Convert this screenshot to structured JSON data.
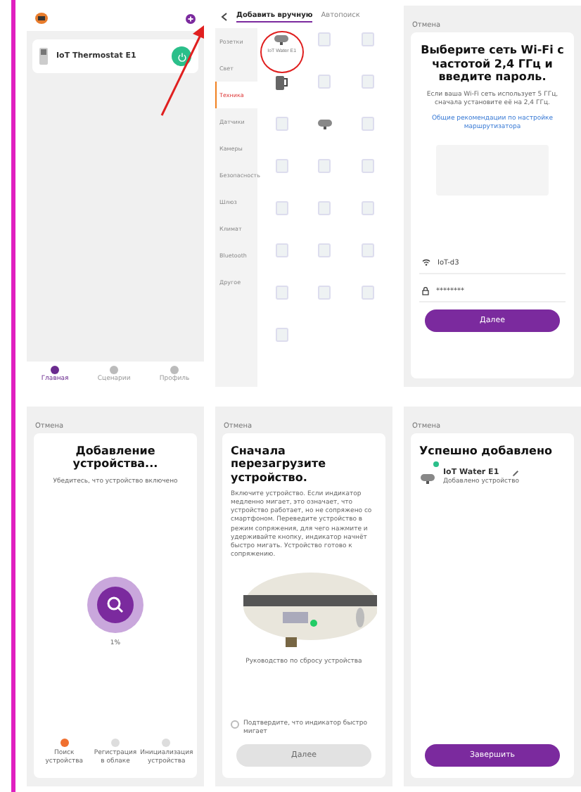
{
  "home": {
    "device": "IoT Thermostat E1",
    "arrow": true,
    "nav": [
      {
        "label": "Главная",
        "selected": true
      },
      {
        "label": "Сценарии",
        "selected": false
      },
      {
        "label": "Профиль",
        "selected": false
      }
    ]
  },
  "add_device": {
    "tabs": [
      {
        "label": "Добавить вручную",
        "selected": true
      },
      {
        "label": "Автопоиск",
        "selected": false
      }
    ],
    "categories": [
      {
        "label": "Розетки",
        "selected": false
      },
      {
        "label": "Свет",
        "selected": false
      },
      {
        "label": "Техника",
        "selected": true
      },
      {
        "label": "Датчики",
        "selected": false
      },
      {
        "label": "Камеры",
        "selected": false
      },
      {
        "label": "Безопасность",
        "selected": false
      },
      {
        "label": "Шлюз",
        "selected": false
      },
      {
        "label": "Климат",
        "selected": false
      },
      {
        "label": "Bluetooth",
        "selected": false
      },
      {
        "label": "Другое",
        "selected": false
      }
    ],
    "devices": [
      {
        "kind": "heater",
        "label": "IoT Water E1",
        "highlighted": true
      },
      {
        "kind": "generic",
        "highlighted": false
      },
      {
        "kind": "generic",
        "highlighted": false
      },
      {
        "kind": "kettle",
        "highlighted": false
      },
      {
        "kind": "generic",
        "highlighted": false
      },
      {
        "kind": "generic",
        "highlighted": false
      },
      {
        "kind": "generic",
        "highlighted": false
      },
      {
        "kind": "heater",
        "highlighted": false
      },
      {
        "kind": "generic",
        "highlighted": false
      },
      {
        "kind": "generic",
        "highlighted": false
      },
      {
        "kind": "generic",
        "highlighted": false
      },
      {
        "kind": "generic",
        "highlighted": false
      },
      {
        "kind": "generic",
        "highlighted": false
      },
      {
        "kind": "generic",
        "highlighted": false
      },
      {
        "kind": "generic",
        "highlighted": false
      },
      {
        "kind": "generic",
        "highlighted": false
      },
      {
        "kind": "generic",
        "highlighted": false
      },
      {
        "kind": "generic",
        "highlighted": false
      },
      {
        "kind": "generic",
        "highlighted": false
      },
      {
        "kind": "generic",
        "highlighted": false
      },
      {
        "kind": "generic",
        "highlighted": false
      },
      {
        "kind": "generic",
        "highlighted": false
      }
    ]
  },
  "wifi": {
    "cancel": "Отмена",
    "title": "Выберите сеть Wi-Fi с частотой 2,4 ГГц и введите пароль.",
    "hint": "Если ваша Wi-Fi сеть использует 5 ГГц, сначала установите её на 2,4 ГГц.",
    "link": "Общие рекомендации по настройке маршрутизатора",
    "network": "IoT-d3",
    "password": "********",
    "button": "Далее"
  },
  "adding": {
    "cancel": "Отмена",
    "title": "Добавление устройства...",
    "subtitle": "Убедитесь, что устройство включено",
    "progress": "1%",
    "steps": [
      {
        "label": "Поиск устройства",
        "done": true
      },
      {
        "label": "Регистрация в облаке",
        "done": false
      },
      {
        "label": "Инициализация устройства",
        "done": false
      }
    ]
  },
  "reset": {
    "cancel": "Отмена",
    "title": "Сначала перезагрузите устройство.",
    "text": "Включите устройство. Если индикатор медленно мигает, это означает, что устройство работает, но не сопряжено со смартфоном. Переведите устройство в режим сопряжения, для чего нажмите и удерживайте кнопку, индикатор начнёт быстро мигать. Устройство готово к сопряжению.",
    "caption": "Руководство по сбросу устройства",
    "confirm": {
      "label": "Подтвердите, что индикатор быстро мигает",
      "checked": false
    },
    "button": {
      "label": "Далее",
      "disabled": true
    }
  },
  "success": {
    "cancel": "Отмена",
    "title": "Успешно добавлено",
    "device": "IoT Water E1",
    "subtitle": "Добавлено устройство",
    "online": true,
    "button": "Завершить"
  }
}
